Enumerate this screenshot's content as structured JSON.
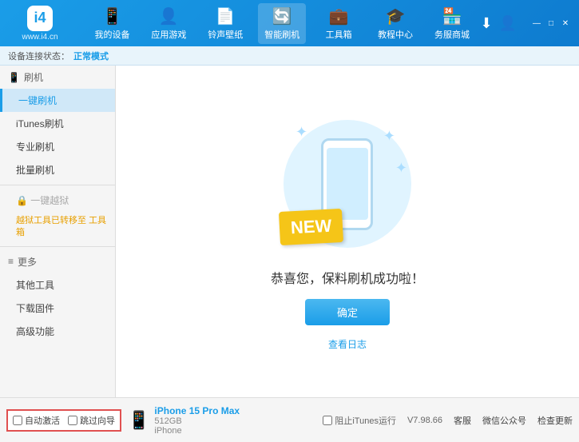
{
  "header": {
    "logo_text": "www.i4.cn",
    "logo_symbol": "i4",
    "nav_items": [
      {
        "label": "我的设备",
        "icon": "📱",
        "id": "my-device"
      },
      {
        "label": "应用游戏",
        "icon": "👤",
        "id": "apps"
      },
      {
        "label": "铃声壁纸",
        "icon": "📄",
        "id": "ringtones"
      },
      {
        "label": "智能刷机",
        "icon": "🔄",
        "id": "smart-flash",
        "active": true
      },
      {
        "label": "工具箱",
        "icon": "💼",
        "id": "toolbox"
      },
      {
        "label": "教程中心",
        "icon": "🎓",
        "id": "tutorials"
      },
      {
        "label": "务服商城",
        "icon": "🏪",
        "id": "store"
      }
    ],
    "window_controls": [
      "_",
      "□",
      "×"
    ],
    "download_icon": "⬇",
    "user_icon": "👤"
  },
  "toolbar": {
    "prefix": "设备连接状态：",
    "status": "正常模式"
  },
  "sidebar": {
    "flash_section": {
      "label": "刷机",
      "icon": "📱"
    },
    "items": [
      {
        "label": "一键刷机",
        "id": "one-key",
        "active": true
      },
      {
        "label": "iTunes刷机",
        "id": "itunes"
      },
      {
        "label": "专业刷机",
        "id": "pro"
      },
      {
        "label": "批量刷机",
        "id": "batch"
      }
    ],
    "disabled_item": {
      "label": "一键越狱",
      "icon": "🔒"
    },
    "disabled_note": "越狱工具已转移至\n工具箱",
    "more_section": "更多",
    "more_items": [
      {
        "label": "其他工具",
        "id": "other-tools"
      },
      {
        "label": "下载固件",
        "id": "download"
      },
      {
        "label": "高级功能",
        "id": "advanced"
      }
    ]
  },
  "main": {
    "success_title": "恭喜您，保料刷机成功啦！",
    "confirm_button": "确定",
    "log_link": "查看日志",
    "new_badge": "NEW",
    "phone_illustration": "phone"
  },
  "bottom": {
    "auto_activate_label": "自动激活",
    "guide_label": "跳过向导",
    "device_name": "iPhone 15 Pro Max",
    "device_storage": "512GB",
    "device_type": "iPhone",
    "itunes_label": "阻止iTunes运行",
    "version": "V7.98.66",
    "client_label": "客服",
    "wechat_label": "微信公众号",
    "check_update_label": "检查更新"
  }
}
